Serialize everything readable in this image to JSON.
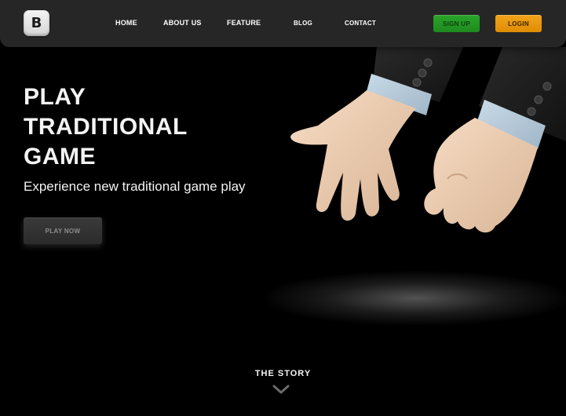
{
  "brand": {
    "logo_letter": "B"
  },
  "nav": {
    "items": [
      {
        "label": "HOME"
      },
      {
        "label": "ABOUT US"
      },
      {
        "label": "FEATURE"
      },
      {
        "label": "BLOG"
      },
      {
        "label": "CONTACT"
      }
    ],
    "signup_label": "SIGN UP",
    "login_label": "LOGIN"
  },
  "hero": {
    "title": "PLAY\nTRADITIONAL\nGAME",
    "subtitle": "Experience new traditional game play",
    "cta_label": "PLAY NOW",
    "illustration": "rock-paper-scissors-hands"
  },
  "story": {
    "label": "THE STORY",
    "icon": "chevron-down-icon"
  },
  "colors": {
    "background": "#000000",
    "navbar": "#262626",
    "signup": "#229a22",
    "login": "#ea9a0e",
    "play_button": "#333333"
  }
}
